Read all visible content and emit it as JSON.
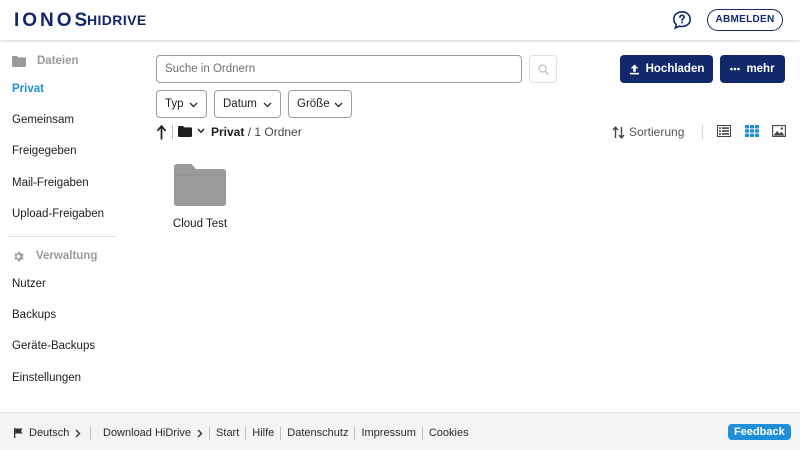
{
  "header": {
    "logo": "IONOS",
    "product": "HIDRIVE",
    "help_icon": "help-chat-icon",
    "logout_label": "ABMELDEN"
  },
  "sidebar": {
    "files_section": {
      "icon": "folder-icon",
      "label": "Dateien"
    },
    "files_items": [
      {
        "label": "Privat",
        "active": true
      },
      {
        "label": "Gemeinsam"
      },
      {
        "label": "Freigegeben"
      },
      {
        "label": "Mail-Freigaben"
      },
      {
        "label": "Upload-Freigaben"
      }
    ],
    "admin_section": {
      "icon": "gear-icon",
      "label": "Verwaltung"
    },
    "admin_items": [
      {
        "label": "Nutzer"
      },
      {
        "label": "Backups"
      },
      {
        "label": "Geräte-Backups"
      },
      {
        "label": "Einstellungen"
      }
    ]
  },
  "toolbar": {
    "search_placeholder": "Suche in Ordnern",
    "upload_label": "Hochladen",
    "more_label": "mehr",
    "filters": [
      {
        "label": "Typ"
      },
      {
        "label": "Datum"
      },
      {
        "label": "Größe"
      }
    ]
  },
  "breadcrumb": {
    "current": "Privat",
    "count": "/ 1 Ordner"
  },
  "view": {
    "sort_label": "Sortierung",
    "modes": [
      "list-view-icon",
      "grid-view-icon",
      "image-view-icon"
    ],
    "active_mode": "grid-view-icon"
  },
  "items": [
    {
      "name": "Cloud Test",
      "type": "folder"
    }
  ],
  "footer": {
    "language": "Deutsch",
    "links": [
      "Download HiDrive",
      "Start",
      "Hilfe",
      "Datenschutz",
      "Impressum",
      "Cookies"
    ],
    "feedback_label": "Feedback"
  },
  "colors": {
    "brand": "#11296b",
    "accent": "#1e8fd8",
    "folder": "#9a9a9a"
  }
}
